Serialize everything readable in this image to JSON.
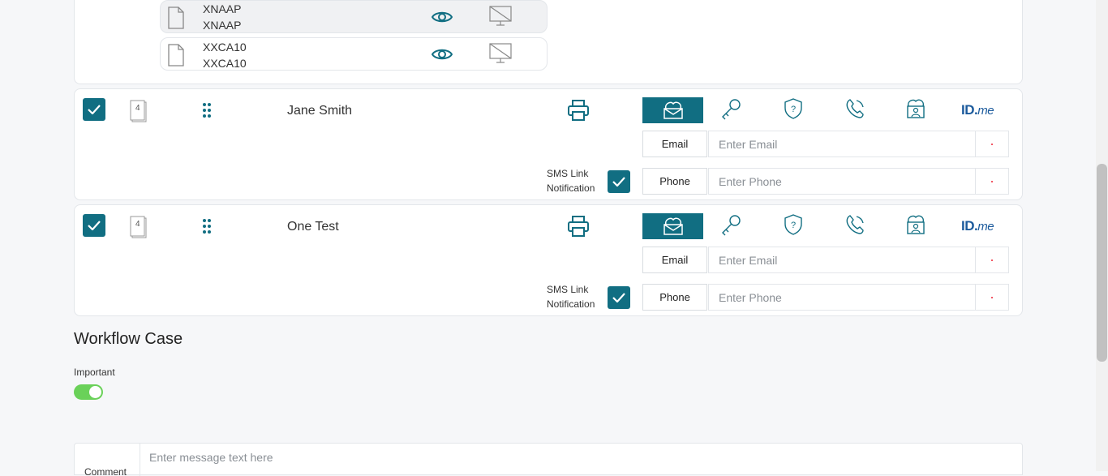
{
  "documents": [
    {
      "line1": "XNAAP",
      "line2": "XNAAP"
    },
    {
      "line1": "XXCA10",
      "line2": "XXCA10"
    }
  ],
  "recipients": [
    {
      "name": "Jane Smith",
      "page_badge": "4",
      "email_label": "Email",
      "email_placeholder": "Enter Email",
      "phone_label": "Phone",
      "phone_placeholder": "Enter Phone",
      "sms_line1": "SMS Link",
      "sms_line2": "Notification",
      "idme_main": "ID.",
      "idme_suffix": "me"
    },
    {
      "name": "One Test",
      "page_badge": "4",
      "email_label": "Email",
      "email_placeholder": "Enter Email",
      "phone_label": "Phone",
      "phone_placeholder": "Enter Phone",
      "sms_line1": "SMS Link",
      "sms_line2": "Notification",
      "idme_main": "ID.",
      "idme_suffix": "me"
    }
  ],
  "workflow": {
    "title": "Workflow Case",
    "important_label": "Important",
    "important_on": true
  },
  "comment": {
    "label": "Comment",
    "placeholder": "Enter message text here"
  },
  "colors": {
    "accent": "#116e82",
    "toggle_on": "#6ad159",
    "idme": "#1b5a9c"
  },
  "icons": [
    "file-icon",
    "eye-icon",
    "monitor-off-icon",
    "pages-icon",
    "drag-handle-icon",
    "printer-icon",
    "email-cloud-icon",
    "key-icon",
    "question-shield-icon",
    "phone-icon",
    "id-card-icon",
    "checkmark-icon"
  ]
}
